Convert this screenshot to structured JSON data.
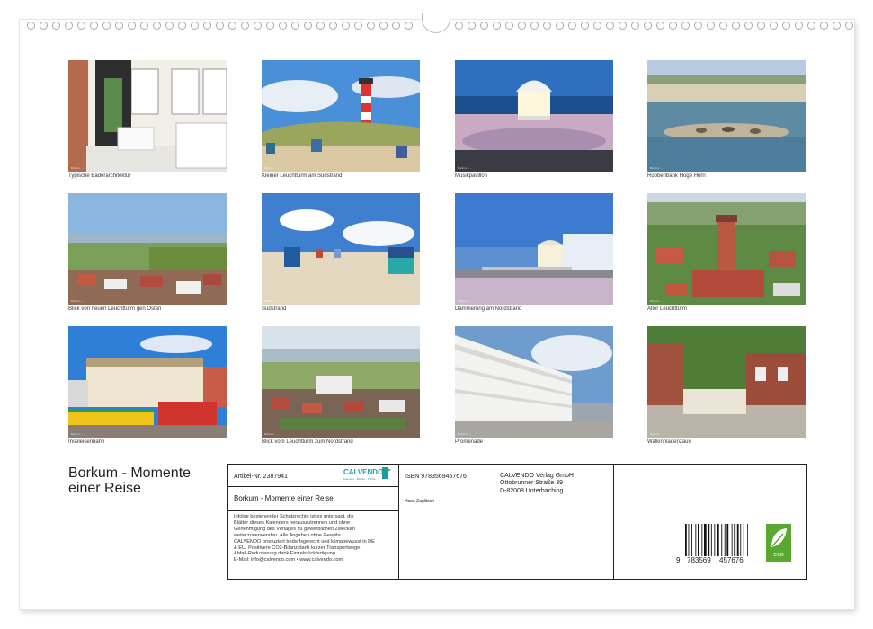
{
  "calendar": {
    "title": "Borkum - Momente einer Reise",
    "photos": [
      {
        "caption": "Typische Bäderarchitektur",
        "credit": "Borkum  ......",
        "scene": "veranda"
      },
      {
        "caption": "Kleiner Leuchtturm am Südstrand",
        "credit": "Borkum  ......",
        "scene": "lighthouse-dunes"
      },
      {
        "caption": "Musikpavillon",
        "credit": "Borkum  ......",
        "scene": "pavilion-night"
      },
      {
        "caption": "Robbenbank Hoge Hörn",
        "credit": "Borkum  ......",
        "scene": "seals"
      },
      {
        "caption": "Blick von neuen Leuchtturm gen Osten",
        "credit": "Borkum  ......",
        "scene": "town-view"
      },
      {
        "caption": "Südstrand",
        "credit": "Borkum  ......",
        "scene": "beach-chairs"
      },
      {
        "caption": "Dämmerung am Nordstrand",
        "credit": "Borkum  ......",
        "scene": "promenade-dusk"
      },
      {
        "caption": "Alter Leuchtturm",
        "credit": "Borkum  ......",
        "scene": "old-lighthouse"
      },
      {
        "caption": "Inseleisenbahn",
        "credit": "Borkum  ......",
        "scene": "train"
      },
      {
        "caption": "Blick vom Leuchtturm zum Nordstrand",
        "credit": "Borkum  ......",
        "scene": "north-view"
      },
      {
        "caption": "Promenade",
        "credit": "Borkum  ......",
        "scene": "promenade-hotel"
      },
      {
        "caption": "Walkinnladenzaun",
        "credit": "Borkum  ......",
        "scene": "whalebone-fence"
      }
    ]
  },
  "info": {
    "article": "Artikel-Nr. 2387941",
    "brand": "CALVENDO",
    "brand_sub": "Kalender · Bücher · Puzzle",
    "subtitle": "Borkum - Momente einer Reise",
    "isbn": "ISBN 9783569457676",
    "publisher": [
      "CALVENDO Verlag GmbH",
      "Ottobrunner Straße 39",
      "D-82008 Unterhaching"
    ],
    "author": "Hans Zaglitsch",
    "legal": [
      "Infolge bestehender Schutzrechte ist es untersagt, die",
      "Blätter dieses Kalenders herauszutrennen und ohne",
      "Genehmigung des Verlages zu gewerblichen Zwecken",
      "weiterzuverwenden. Alle Angaben ohne Gewähr.",
      "CALVENDO produziert bedarfsgerecht und klimabewusst in DE",
      "& EU. Positivere CO2-Bilanz dank kurzer Transportwege.",
      "Abfall-Reduzierung dank Einzelstückfertigung.",
      "E-Mail: info@calvendo.com • www.calvendo.com"
    ],
    "barcode_digits": [
      "9",
      "783569",
      "457676"
    ],
    "eco_label": "eco",
    "brand_color": "#1d9aa8",
    "eco_color": "#5aa832"
  }
}
